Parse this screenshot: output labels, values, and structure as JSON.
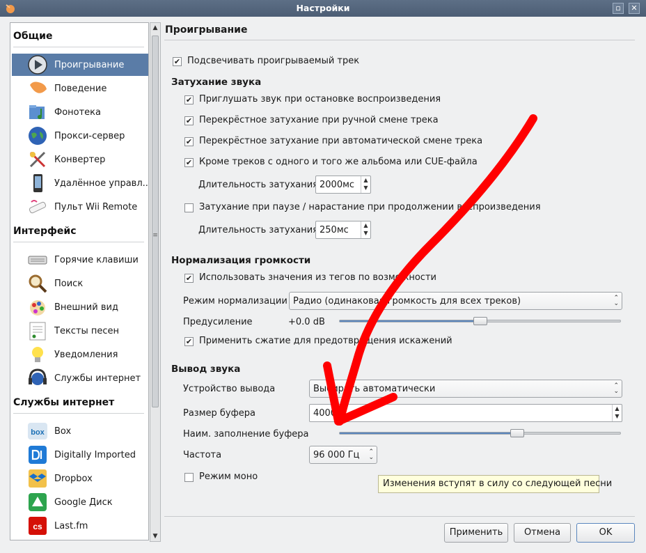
{
  "window": {
    "title": "Настройки",
    "icons": {
      "app": "clementine-icon",
      "maximize": "maximize-icon",
      "close": "close-icon"
    },
    "maximize_glyph": "▫",
    "close_glyph": "✕"
  },
  "sidebar": {
    "sections": [
      {
        "title": "Общие",
        "items": [
          {
            "label": "Проигрывание",
            "icon": "play-icon",
            "active": true
          },
          {
            "label": "Поведение",
            "icon": "tangerine-icon"
          },
          {
            "label": "Фонотека",
            "icon": "music-folder-icon"
          },
          {
            "label": "Прокси-сервер",
            "icon": "globe-icon"
          },
          {
            "label": "Конвертер",
            "icon": "transcode-icon"
          },
          {
            "label": "Удалённое управл...",
            "icon": "phone-icon"
          },
          {
            "label": "Пульт Wii Remote",
            "icon": "wiimote-icon"
          }
        ]
      },
      {
        "title": "Интерфейс",
        "items": [
          {
            "label": "Горячие клавиши",
            "icon": "keyboard-icon"
          },
          {
            "label": "Поиск",
            "icon": "magnifier-icon"
          },
          {
            "label": "Внешний вид",
            "icon": "palette-icon"
          },
          {
            "label": "Тексты песен",
            "icon": "lyrics-icon"
          },
          {
            "label": "Уведомления",
            "icon": "lightbulb-icon"
          },
          {
            "label": "Службы интернет",
            "icon": "headphones-globe-icon"
          }
        ]
      },
      {
        "title": "Службы интернет",
        "items": [
          {
            "label": "Box",
            "icon": "box-icon"
          },
          {
            "label": "Digitally Imported",
            "icon": "digitally-imported-icon"
          },
          {
            "label": "Dropbox",
            "icon": "dropbox-icon"
          },
          {
            "label": "Google Диск",
            "icon": "google-drive-icon"
          },
          {
            "label": "Last.fm",
            "icon": "lastfm-icon"
          }
        ]
      }
    ]
  },
  "main": {
    "title": "Проигрывание",
    "highlight_track": {
      "label": "Подсвечивать проигрываемый трек",
      "checked": true
    },
    "fade": {
      "title": "Затухание звука",
      "fade_on_stop": {
        "label": "Приглушать звук при остановке воспроизведения",
        "checked": true
      },
      "crossfade_manual": {
        "label": "Перекрёстное затухание при ручной смене трека",
        "checked": true
      },
      "crossfade_auto": {
        "label": "Перекрёстное затухание при автоматической смене трека",
        "checked": true
      },
      "except_same_album": {
        "label": "Кроме треков с одного и того же альбома или CUE-файла",
        "checked": true
      },
      "duration_label": "Длительность затухания",
      "duration_value": "2000мс",
      "fade_on_pause": {
        "label": "Затухание при паузе / нарастание при продолжении воспроизведения",
        "checked": false
      },
      "pause_duration_label": "Длительность затухания",
      "pause_duration_value": "250мс"
    },
    "normalization": {
      "title": "Нормализация громкости",
      "use_tags": {
        "label": "Использовать значения из тегов по возможности",
        "checked": true
      },
      "mode_label": "Режим нормализации",
      "mode_value": "Радио (одинаковая громкость для всех треков)",
      "preamp_label": "Предусиление",
      "preamp_value": "+0.0 dB",
      "preamp_level": 0.5,
      "compression": {
        "label": "Применить сжатие для предотвращения искажений",
        "checked": true
      }
    },
    "output": {
      "title": "Вывод звука",
      "device_label": "Устройство вывода",
      "device_value": "Выбирать автоматически",
      "buffer_label": "Размер буфера",
      "buffer_value": "4000",
      "min_buffer_label": "Наим. заполнение буфера",
      "min_buffer_level": 0.64,
      "rate_label": "Частота",
      "rate_value": "96 000 Гц",
      "mono": {
        "label": "Режим моно",
        "checked": false
      },
      "tooltip": "Изменения вступят в силу со следующей песни"
    }
  },
  "buttons": {
    "apply": "Применить",
    "cancel": "Отмена",
    "ok": "OK"
  },
  "glyphs": {
    "check": "✔",
    "spin_up": "▲",
    "spin_down": "▼",
    "combo": "⌃⌄",
    "scroll_up": "▲",
    "scroll_down": "▼",
    "grip": "≡"
  },
  "colors": {
    "selection": "#5a7ca7",
    "accent": "#5a86bd",
    "annotation": "#ff0000"
  }
}
